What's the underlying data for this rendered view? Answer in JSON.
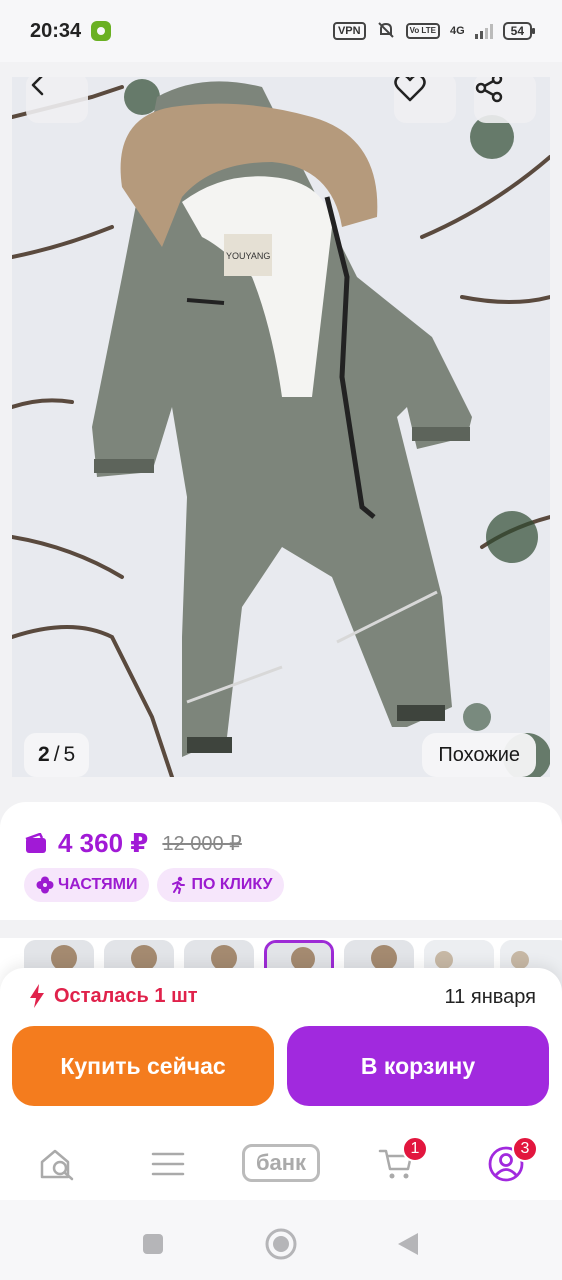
{
  "status_bar": {
    "time": "20:34",
    "vpn_label": "VPN",
    "volte_label": "Vo LTE",
    "network_label": "4G",
    "battery_level": "54"
  },
  "gallery": {
    "current": "2",
    "separator": "/",
    "total": "5",
    "similar_label": "Похожие",
    "photo_tag_label": "YOUYANG",
    "icons": {
      "back": "chevron-left-icon",
      "favorite": "heart-icon",
      "share": "share-icon"
    }
  },
  "price": {
    "current": "4 360 ₽",
    "old": "12 000 ₽",
    "accent_color": "#a11ad6"
  },
  "chips": [
    {
      "label": "ЧАСТЯМИ",
      "icon": "clover-icon"
    },
    {
      "label": "ПО КЛИКУ",
      "icon": "running-person-icon"
    }
  ],
  "thumbnails": {
    "count": 7,
    "selected_index": 3
  },
  "purchase": {
    "stock_text": "Осталась 1 шт",
    "delivery_date": "11 января",
    "buy_now_label": "Купить сейчас",
    "add_to_cart_label": "В корзину",
    "buy_color": "#f47c1e",
    "cart_color": "#a129de"
  },
  "tab_bar": {
    "items": [
      {
        "name": "home-search",
        "icon": "home-search-icon"
      },
      {
        "name": "catalog",
        "icon": "menu-icon"
      },
      {
        "name": "bank",
        "label": "банк"
      },
      {
        "name": "cart",
        "icon": "cart-icon",
        "badge": "1"
      },
      {
        "name": "profile",
        "icon": "profile-icon",
        "badge": "3"
      }
    ]
  },
  "system_nav": {
    "icons": [
      "recent-apps-icon",
      "home-circle-icon",
      "back-triangle-icon"
    ]
  }
}
